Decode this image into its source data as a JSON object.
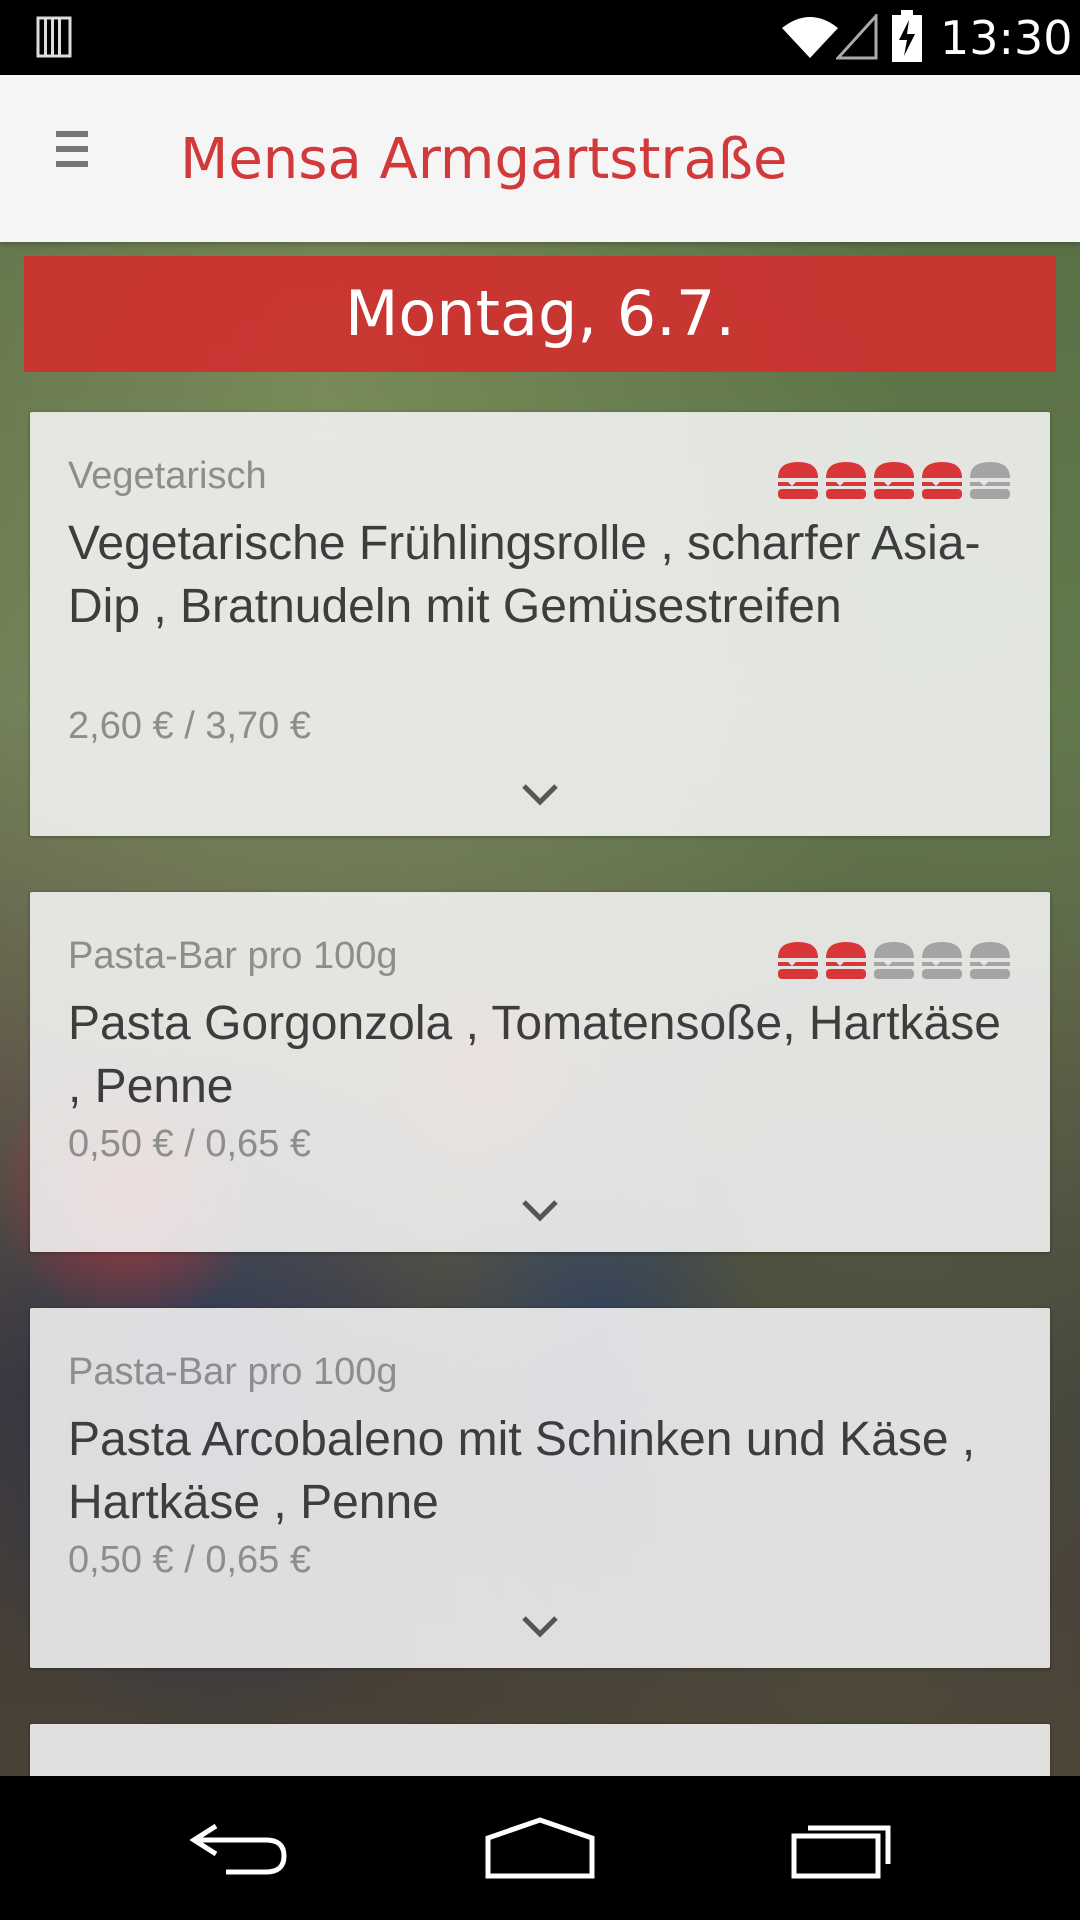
{
  "status_bar": {
    "time": "13:30",
    "icons": [
      "storage-icon",
      "wifi-icon",
      "signal-icon",
      "battery-charging-icon"
    ]
  },
  "app_bar": {
    "title": "Mensa Armgartstraße",
    "menu_icon": "hamburger-menu-icon"
  },
  "day": {
    "label": "Montag, 6.7."
  },
  "colors": {
    "accent": "#d2393a",
    "rating_active": "#d9363a",
    "rating_inactive": "#a4a4a4"
  },
  "meals": [
    {
      "category": "Vegetarisch",
      "title": "Vegetarische Frühlingsrolle , scharfer Asia-Dip , Bratnudeln mit Gemüsestreifen",
      "price": "2,60 € / 3,70 €",
      "rating": 4,
      "rating_max": 5
    },
    {
      "category": "Pasta-Bar pro 100g",
      "title": "Pasta Gorgonzola , Tomatensoße, Hartkäse , Penne",
      "price": "0,50 € / 0,65 €",
      "rating": 2,
      "rating_max": 5
    },
    {
      "category": "Pasta-Bar pro 100g",
      "title": "Pasta Arcobaleno mit Schinken und Käse , Hartkäse , Penne",
      "price": "0,50 € / 0,65 €"
    }
  ],
  "nav_bar": {
    "icons": [
      "back-icon",
      "home-icon",
      "recents-icon"
    ]
  }
}
